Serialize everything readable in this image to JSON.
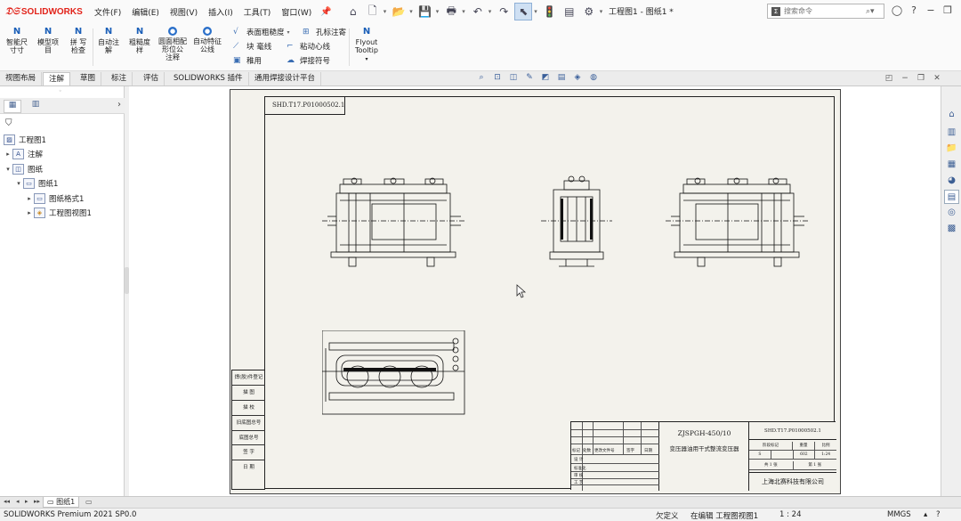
{
  "app": {
    "brand": "SOLIDWORKS",
    "doc_title": "工程图1 - 图纸1 *"
  },
  "menu": [
    "文件(F)",
    "编辑(E)",
    "视图(V)",
    "插入(I)",
    "工具(T)",
    "窗口(W)"
  ],
  "search": {
    "placeholder": "搜索命令"
  },
  "ribbon": {
    "smart_dim": [
      "智能尺",
      "寸寸"
    ],
    "model_items": [
      "模型项",
      "目"
    ],
    "spell_check": [
      "拼 写",
      "检查"
    ],
    "auto_balloon": [
      "自动注",
      "解"
    ],
    "roughness": [
      "粗糙度",
      "样"
    ],
    "surface_form": [
      "圆面相配",
      "形位公",
      "注释"
    ],
    "auto_tol": [
      "自动特征",
      "公线"
    ],
    "surface_roughness": "表面粗糙度",
    "block_line": "块 毫线",
    "datum": "稚用",
    "hole_callout": "孔标注寄",
    "auto_centerline": "粘动心线",
    "weld_symbol": "焊接符号",
    "flyout": [
      "Flyout",
      "Tooltip"
    ]
  },
  "tabs": [
    "视图布局",
    "注解",
    "草图",
    "标注",
    "评估",
    "SOLIDWORKS 插件",
    "通用焊接设计平台"
  ],
  "active_tab": 1,
  "tree": {
    "root": "工程图1",
    "annotations": "注解",
    "sheet_folder": "图纸",
    "sheet": "图纸1",
    "sheet_format": "图纸格式1",
    "drawing_view": "工程图视图1"
  },
  "drawing": {
    "code": "SHD.T17.P01000502.1",
    "side_labels": [
      "焊(胶)件登记",
      "描 图",
      "描 校",
      "旧底图总号",
      "底图总号",
      "签 字",
      "日 期"
    ],
    "model": "ZJSPGH-450/10",
    "description": "变压器油用干式整流变压器",
    "company": "上海北赛科技有限公司",
    "tb_labels": [
      "标记",
      "处数",
      "更改文件号",
      "签字",
      "日期",
      "设 计",
      "标准化",
      "审 核",
      "工 艺"
    ],
    "tb_right_head": [
      "阶段标记",
      "重量",
      "比例"
    ],
    "tb_right_vals": [
      "S",
      "",
      "602",
      "1:24"
    ],
    "tb_sheets": [
      "共 1 张",
      "第 1 张"
    ]
  },
  "sheet_tab": "图纸1",
  "status": {
    "product": "SOLIDWORKS Premium 2021 SP0.0",
    "underdefined": "欠定义",
    "editing": "在编辑 工程图视图1",
    "scale": "1 : 24",
    "units": "MMGS"
  }
}
